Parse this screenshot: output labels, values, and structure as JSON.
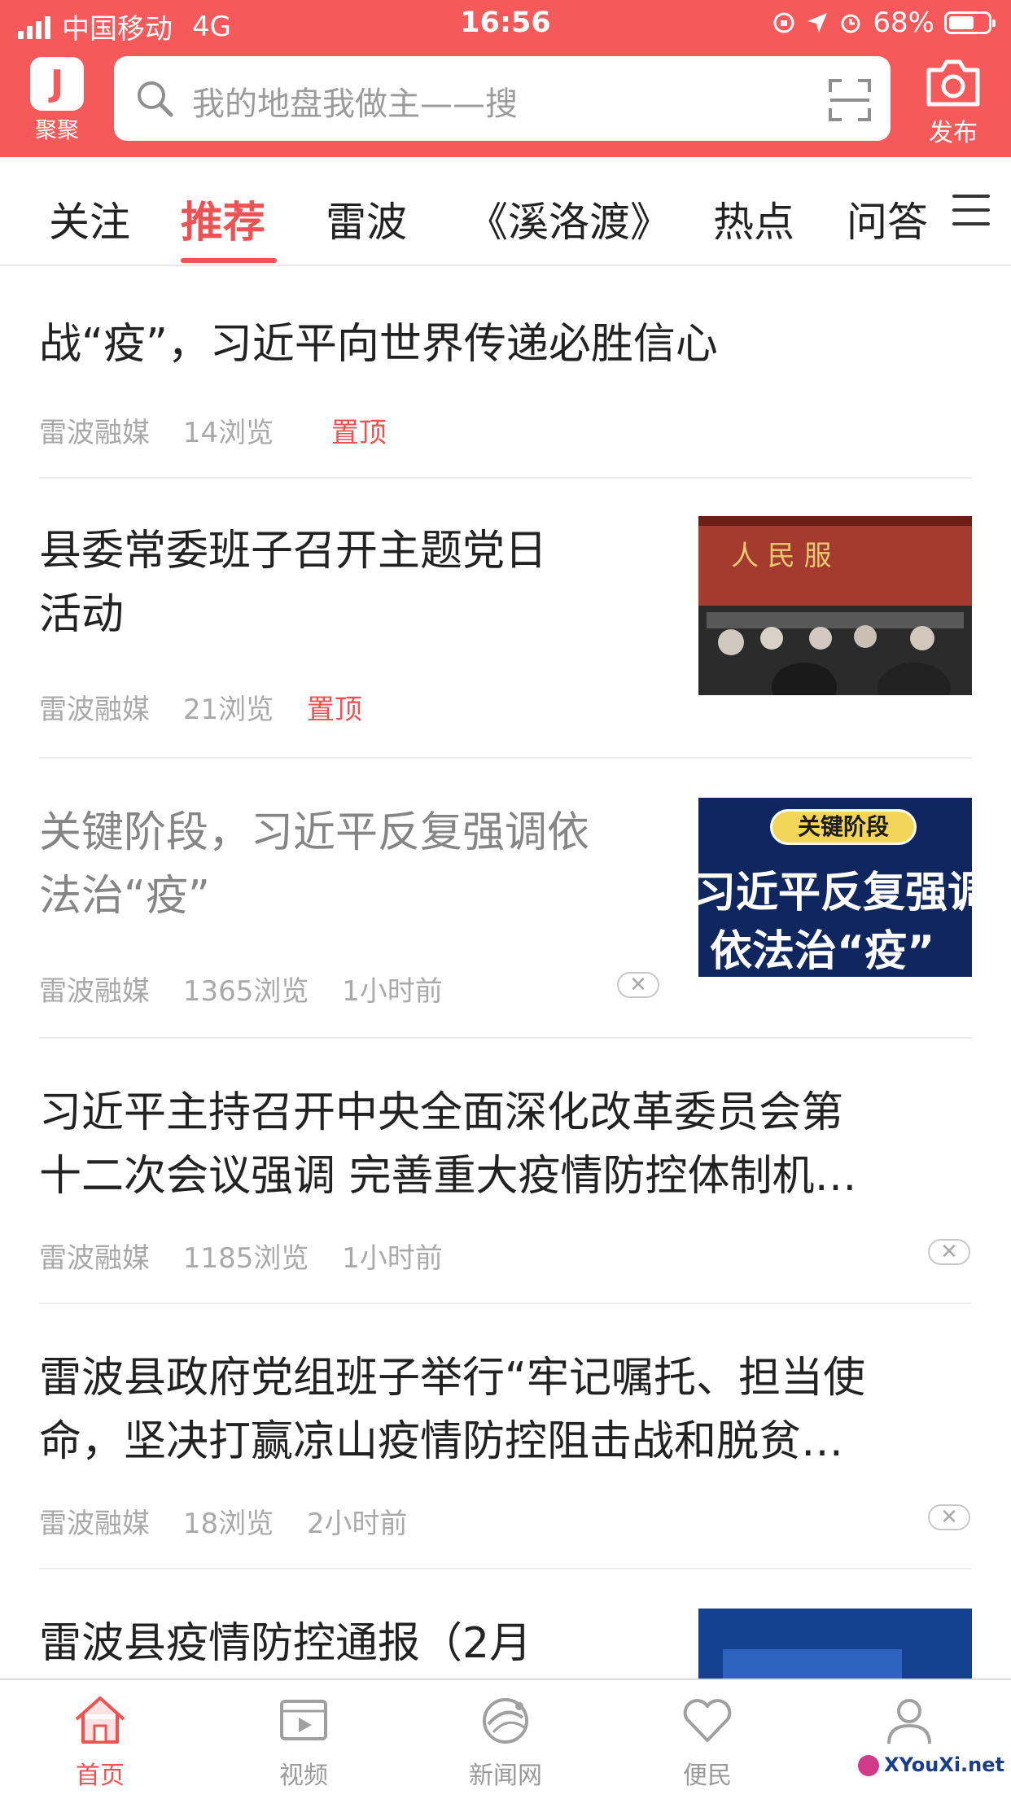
{
  "status": {
    "carrier": "中国移动",
    "network": "4G",
    "time": "16:56",
    "battery": "68%",
    "battery_level": 0.68
  },
  "header": {
    "logo_label": "聚聚",
    "logo_glyph": "J",
    "search_placeholder": "我的地盘我做主——搜",
    "publish_label": "发布",
    "accent": "#f5595a"
  },
  "tabs": [
    {
      "label": "关注"
    },
    {
      "label": "推荐",
      "active": true
    },
    {
      "label": "雷波"
    },
    {
      "label": "《溪洛渡》"
    },
    {
      "label": "热点"
    },
    {
      "label": "问答"
    }
  ],
  "feed": [
    {
      "title": "战“疫”，习近平向世界传递必胜信心",
      "source": "雷波融媒",
      "views": "14浏览",
      "tag": "置顶"
    },
    {
      "title_l1": "县委常委班子召开主题党日",
      "title_l2": "活动",
      "source": "雷波融媒",
      "views": "21浏览",
      "tag": "置顶"
    },
    {
      "title_l1": "关键阶段，习近平反复强调依",
      "title_l2": "法治“疫”",
      "source": "雷波融媒",
      "views": "1365浏览",
      "time": "1小时前",
      "thumb_badge": "关键阶段",
      "thumb_l1": "习近平反复强调",
      "thumb_l2": "依法治“疫”"
    },
    {
      "title_l1": "习近平主持召开中央全面深化改革委员会第",
      "title_l2": "十二次会议强调 完善重大疫情防控体制机…",
      "source": "雷波融媒",
      "views": "1185浏览",
      "time": "1小时前"
    },
    {
      "title_l1": "雷波县政府党组班子举行“牢记嘱托、担当使",
      "title_l2": "命，坚决打赢凉山疫情防控阻击战和脱贫…",
      "source": "雷波融媒",
      "views": "18浏览",
      "time": "2小时前"
    },
    {
      "title": "雷波县疫情防控通报（2月"
    }
  ],
  "bottom_nav": [
    {
      "label": "首页",
      "icon": "home-icon",
      "active": true
    },
    {
      "label": "视频",
      "icon": "video-icon"
    },
    {
      "label": "新闻网",
      "icon": "news-icon"
    },
    {
      "label": "便民",
      "icon": "heart-icon"
    },
    {
      "label": "",
      "icon": "user-icon"
    }
  ],
  "watermark": "XYouXi.net"
}
